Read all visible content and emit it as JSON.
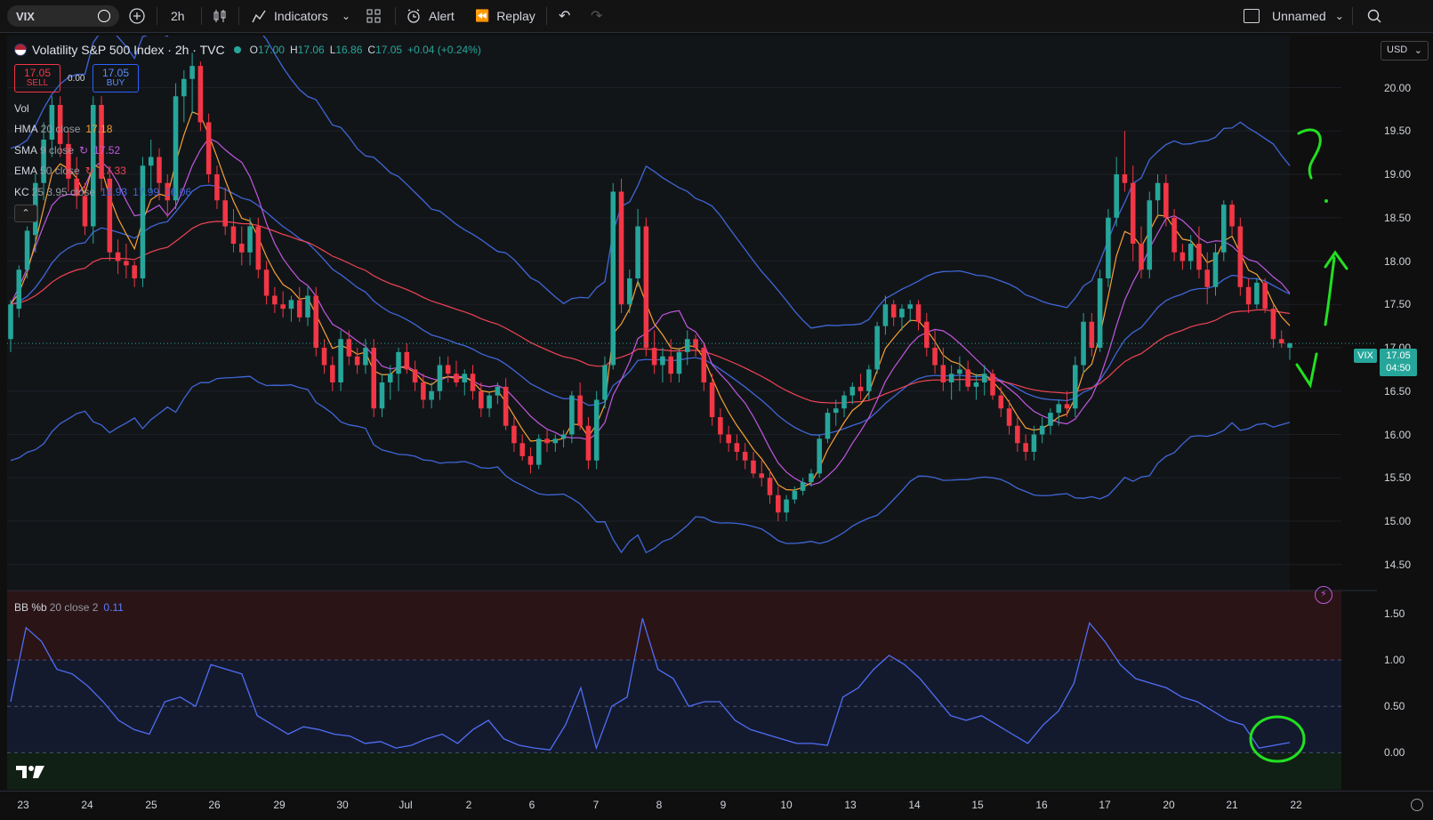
{
  "toolbar": {
    "symbol": "VIX",
    "interval": "2h",
    "indicators_label": "Indicators",
    "alert_label": "Alert",
    "replay_label": "Replay",
    "layout_name": "Unnamed"
  },
  "header": {
    "title": "Volatility S&P 500 Index · 2h · TVC",
    "o_label": "O",
    "o_value": "17.00",
    "h_label": "H",
    "h_value": "17.06",
    "l_label": "L",
    "l_value": "16.86",
    "c_label": "C",
    "c_value": "17.05",
    "change": "+0.04 (+0.24%)",
    "currency": "USD"
  },
  "trade": {
    "sell_price": "17.05",
    "sell_label": "SELL",
    "spread": "0.00",
    "buy_price": "17.05",
    "buy_label": "BUY"
  },
  "legend": {
    "vol": "Vol",
    "hma": {
      "name": "HMA",
      "params": "20 close",
      "value": "17.18"
    },
    "sma": {
      "name": "SMA",
      "params": "9 close",
      "value": "17.52"
    },
    "ema": {
      "name": "EMA",
      "params": "50 close",
      "value": "17.33"
    },
    "kc": {
      "name": "KC",
      "params": "25 3.95 close",
      "v1": "19.93",
      "v2": "17.99",
      "v3": "16.06"
    }
  },
  "price_tag": {
    "symbol": "VIX",
    "price": "17.05",
    "countdown": "04:50"
  },
  "bb_legend": {
    "name": "BB %b",
    "params": "20 close 2",
    "value": "0.11"
  },
  "colors": {
    "up": "#26a69a",
    "down": "#f23645",
    "hma": "#f7a035",
    "sma": "#c158e0",
    "ema": "#f04455",
    "kc": "#3f66d8",
    "annotation": "#22e022"
  },
  "chart_data": {
    "type": "candlestick",
    "price_ticks": [
      "20.00",
      "19.50",
      "19.00",
      "18.50",
      "18.00",
      "17.50",
      "17.00",
      "16.50",
      "16.00",
      "15.50",
      "15.00",
      "14.50"
    ],
    "bb_ticks": [
      "1.50",
      "1.00",
      "0.50",
      "0.00"
    ],
    "x_labels": [
      "23",
      "24",
      "25",
      "26",
      "29",
      "30",
      "Jul",
      "2",
      "6",
      "7",
      "8",
      "9",
      "10",
      "13",
      "14",
      "15",
      "16",
      "17",
      "20",
      "21",
      "22"
    ],
    "last_price": 17.05,
    "ohlc": [
      [
        17.1,
        17.55,
        16.95,
        17.5
      ],
      [
        17.45,
        17.95,
        17.35,
        17.9
      ],
      [
        17.9,
        18.4,
        17.8,
        18.35
      ],
      [
        18.3,
        19.0,
        18.1,
        18.9
      ],
      [
        18.9,
        19.6,
        18.7,
        19.4
      ],
      [
        19.4,
        19.9,
        19.2,
        19.8
      ],
      [
        19.8,
        19.9,
        19.2,
        19.35
      ],
      [
        19.35,
        19.5,
        18.8,
        18.95
      ],
      [
        18.95,
        19.2,
        18.6,
        18.75
      ],
      [
        18.75,
        18.9,
        18.3,
        18.4
      ],
      [
        18.4,
        19.9,
        18.2,
        19.8
      ],
      [
        19.8,
        19.9,
        18.8,
        18.95
      ],
      [
        18.95,
        19.05,
        18.0,
        18.1
      ],
      [
        18.1,
        18.25,
        17.85,
        18.0
      ],
      [
        18.0,
        18.2,
        17.8,
        17.95
      ],
      [
        17.95,
        18.0,
        17.7,
        17.8
      ],
      [
        17.8,
        19.2,
        17.7,
        19.1
      ],
      [
        19.1,
        19.4,
        18.8,
        19.2
      ],
      [
        19.2,
        19.3,
        18.7,
        18.9
      ],
      [
        18.9,
        19.0,
        18.5,
        18.7
      ],
      [
        18.7,
        20.05,
        18.6,
        19.9
      ],
      [
        19.9,
        20.2,
        19.6,
        20.1
      ],
      [
        20.1,
        20.4,
        19.7,
        20.25
      ],
      [
        20.25,
        20.3,
        19.5,
        19.6
      ],
      [
        19.6,
        19.7,
        18.9,
        19.0
      ],
      [
        19.0,
        19.1,
        18.6,
        18.7
      ],
      [
        18.7,
        18.85,
        18.3,
        18.4
      ],
      [
        18.4,
        18.6,
        18.1,
        18.2
      ],
      [
        18.2,
        18.4,
        17.95,
        18.1
      ],
      [
        18.1,
        18.5,
        17.95,
        18.4
      ],
      [
        18.4,
        18.5,
        17.8,
        17.9
      ],
      [
        17.9,
        18.0,
        17.5,
        17.6
      ],
      [
        17.6,
        17.7,
        17.4,
        17.5
      ],
      [
        17.5,
        17.65,
        17.35,
        17.45
      ],
      [
        17.45,
        17.6,
        17.3,
        17.55
      ],
      [
        17.55,
        17.7,
        17.3,
        17.35
      ],
      [
        17.35,
        17.7,
        17.25,
        17.6
      ],
      [
        17.6,
        17.7,
        16.9,
        17.0
      ],
      [
        17.0,
        17.1,
        16.7,
        16.8
      ],
      [
        16.8,
        16.9,
        16.5,
        16.6
      ],
      [
        16.6,
        17.2,
        16.5,
        17.1
      ],
      [
        17.1,
        17.2,
        16.8,
        16.9
      ],
      [
        16.9,
        17.0,
        16.7,
        16.8
      ],
      [
        16.8,
        17.1,
        16.7,
        17.0
      ],
      [
        17.0,
        17.1,
        16.2,
        16.3
      ],
      [
        16.3,
        16.7,
        16.2,
        16.6
      ],
      [
        16.6,
        16.8,
        16.4,
        16.7
      ],
      [
        16.7,
        17.0,
        16.5,
        16.95
      ],
      [
        16.95,
        17.05,
        16.7,
        16.75
      ],
      [
        16.75,
        16.85,
        16.5,
        16.6
      ],
      [
        16.6,
        16.7,
        16.3,
        16.4
      ],
      [
        16.4,
        16.6,
        16.3,
        16.5
      ],
      [
        16.5,
        16.9,
        16.4,
        16.8
      ],
      [
        16.8,
        16.9,
        16.6,
        16.7
      ],
      [
        16.7,
        16.85,
        16.55,
        16.6
      ],
      [
        16.6,
        16.75,
        16.45,
        16.7
      ],
      [
        16.7,
        16.8,
        16.4,
        16.5
      ],
      [
        16.5,
        16.6,
        16.2,
        16.3
      ],
      [
        16.3,
        16.5,
        16.2,
        16.45
      ],
      [
        16.45,
        16.6,
        16.35,
        16.55
      ],
      [
        16.55,
        16.65,
        16.05,
        16.1
      ],
      [
        16.1,
        16.2,
        15.8,
        15.9
      ],
      [
        15.9,
        16.0,
        15.7,
        15.75
      ],
      [
        15.75,
        15.85,
        15.55,
        15.65
      ],
      [
        15.65,
        16.0,
        15.6,
        15.95
      ],
      [
        15.95,
        16.05,
        15.8,
        15.9
      ],
      [
        15.9,
        16.0,
        15.8,
        15.95
      ],
      [
        15.95,
        16.05,
        15.85,
        16.0
      ],
      [
        16.0,
        16.5,
        15.9,
        16.45
      ],
      [
        16.45,
        16.6,
        16.05,
        16.1
      ],
      [
        16.1,
        16.2,
        15.6,
        15.7
      ],
      [
        15.7,
        16.5,
        15.6,
        16.4
      ],
      [
        16.4,
        16.9,
        16.3,
        16.8
      ],
      [
        16.8,
        18.9,
        16.75,
        18.8
      ],
      [
        18.8,
        18.95,
        17.4,
        17.5
      ],
      [
        17.5,
        17.9,
        17.4,
        17.8
      ],
      [
        17.8,
        18.6,
        17.7,
        18.4
      ],
      [
        18.4,
        18.5,
        16.9,
        17.0
      ],
      [
        17.0,
        17.2,
        16.7,
        16.8
      ],
      [
        16.8,
        17.0,
        16.6,
        16.9
      ],
      [
        16.9,
        17.1,
        16.6,
        16.7
      ],
      [
        16.7,
        17.0,
        16.6,
        16.95
      ],
      [
        16.95,
        17.2,
        16.8,
        17.1
      ],
      [
        17.1,
        17.15,
        16.9,
        17.0
      ],
      [
        17.0,
        17.05,
        16.5,
        16.6
      ],
      [
        16.6,
        16.7,
        16.1,
        16.2
      ],
      [
        16.2,
        16.3,
        15.9,
        16.0
      ],
      [
        16.0,
        16.1,
        15.8,
        15.9
      ],
      [
        15.9,
        16.0,
        15.7,
        15.8
      ],
      [
        15.8,
        15.9,
        15.6,
        15.7
      ],
      [
        15.7,
        15.8,
        15.5,
        15.55
      ],
      [
        15.55,
        15.7,
        15.4,
        15.5
      ],
      [
        15.5,
        15.6,
        15.2,
        15.3
      ],
      [
        15.3,
        15.4,
        15.0,
        15.1
      ],
      [
        15.1,
        15.3,
        15.0,
        15.25
      ],
      [
        15.25,
        15.4,
        15.2,
        15.35
      ],
      [
        15.35,
        15.5,
        15.3,
        15.45
      ],
      [
        15.45,
        15.6,
        15.4,
        15.55
      ],
      [
        15.55,
        16.0,
        15.5,
        15.95
      ],
      [
        15.95,
        16.3,
        15.9,
        16.25
      ],
      [
        16.25,
        16.4,
        16.1,
        16.3
      ],
      [
        16.3,
        16.5,
        16.2,
        16.45
      ],
      [
        16.45,
        16.6,
        16.35,
        16.55
      ],
      [
        16.55,
        16.7,
        16.4,
        16.5
      ],
      [
        16.5,
        16.8,
        16.4,
        16.75
      ],
      [
        16.75,
        17.3,
        16.7,
        17.25
      ],
      [
        17.25,
        17.6,
        17.15,
        17.5
      ],
      [
        17.5,
        17.55,
        17.25,
        17.35
      ],
      [
        17.35,
        17.5,
        17.2,
        17.45
      ],
      [
        17.45,
        17.55,
        17.3,
        17.5
      ],
      [
        17.5,
        17.55,
        17.2,
        17.3
      ],
      [
        17.3,
        17.4,
        16.9,
        17.0
      ],
      [
        17.0,
        17.2,
        16.7,
        16.8
      ],
      [
        16.8,
        17.0,
        16.5,
        16.6
      ],
      [
        16.6,
        16.8,
        16.4,
        16.7
      ],
      [
        16.7,
        16.9,
        16.5,
        16.75
      ],
      [
        16.75,
        16.85,
        16.5,
        16.55
      ],
      [
        16.55,
        16.7,
        16.4,
        16.6
      ],
      [
        16.6,
        16.8,
        16.45,
        16.7
      ],
      [
        16.7,
        16.75,
        16.4,
        16.45
      ],
      [
        16.45,
        16.55,
        16.2,
        16.3
      ],
      [
        16.3,
        16.4,
        16.0,
        16.1
      ],
      [
        16.1,
        16.2,
        15.8,
        15.9
      ],
      [
        15.9,
        16.0,
        15.7,
        15.8
      ],
      [
        15.8,
        16.1,
        15.7,
        16.0
      ],
      [
        16.0,
        16.2,
        15.9,
        16.1
      ],
      [
        16.1,
        16.3,
        16.0,
        16.25
      ],
      [
        16.25,
        16.4,
        16.1,
        16.35
      ],
      [
        16.35,
        16.5,
        16.2,
        16.3
      ],
      [
        16.3,
        16.9,
        16.2,
        16.8
      ],
      [
        16.8,
        17.4,
        16.7,
        17.3
      ],
      [
        17.3,
        17.4,
        16.9,
        17.0
      ],
      [
        17.0,
        17.9,
        16.95,
        17.8
      ],
      [
        17.8,
        18.6,
        17.7,
        18.5
      ],
      [
        18.5,
        19.2,
        18.4,
        19.0
      ],
      [
        19.0,
        19.5,
        18.8,
        18.9
      ],
      [
        18.9,
        19.1,
        18.0,
        18.2
      ],
      [
        18.2,
        18.4,
        17.8,
        17.9
      ],
      [
        17.9,
        18.8,
        17.8,
        18.7
      ],
      [
        18.7,
        19.0,
        18.5,
        18.9
      ],
      [
        18.9,
        19.0,
        18.4,
        18.5
      ],
      [
        18.5,
        18.6,
        18.0,
        18.1
      ],
      [
        18.1,
        18.2,
        17.9,
        18.0
      ],
      [
        18.0,
        18.3,
        17.9,
        18.2
      ],
      [
        18.2,
        18.4,
        17.8,
        17.9
      ],
      [
        17.9,
        18.1,
        17.5,
        17.7
      ],
      [
        17.7,
        18.2,
        17.6,
        18.1
      ],
      [
        18.1,
        18.7,
        18.0,
        18.65
      ],
      [
        18.65,
        18.7,
        18.3,
        18.4
      ],
      [
        18.4,
        18.5,
        17.6,
        17.7
      ],
      [
        17.7,
        17.8,
        17.4,
        17.5
      ],
      [
        17.5,
        17.8,
        17.45,
        17.75
      ],
      [
        17.75,
        17.8,
        17.4,
        17.45
      ],
      [
        17.45,
        17.5,
        17.0,
        17.1
      ],
      [
        17.1,
        17.2,
        17.0,
        17.05
      ],
      [
        17.0,
        17.06,
        16.86,
        17.05
      ]
    ],
    "bb_percent": [
      0.55,
      1.35,
      1.2,
      0.9,
      0.85,
      0.72,
      0.55,
      0.35,
      0.25,
      0.2,
      0.55,
      0.6,
      0.5,
      0.95,
      0.9,
      0.85,
      0.4,
      0.3,
      0.2,
      0.28,
      0.25,
      0.2,
      0.18,
      0.1,
      0.12,
      0.05,
      0.08,
      0.15,
      0.2,
      0.1,
      0.25,
      0.35,
      0.15,
      0.08,
      0.05,
      0.03,
      0.3,
      0.7,
      0.05,
      0.5,
      0.6,
      1.45,
      0.9,
      0.8,
      0.5,
      0.55,
      0.55,
      0.35,
      0.25,
      0.2,
      0.15,
      0.1,
      0.1,
      0.08,
      0.6,
      0.7,
      0.9,
      1.05,
      0.95,
      0.8,
      0.6,
      0.4,
      0.35,
      0.4,
      0.3,
      0.2,
      0.1,
      0.3,
      0.45,
      0.75,
      1.4,
      1.2,
      0.95,
      0.8,
      0.75,
      0.7,
      0.6,
      0.55,
      0.45,
      0.35,
      0.3,
      0.05,
      0.08,
      0.11
    ]
  }
}
